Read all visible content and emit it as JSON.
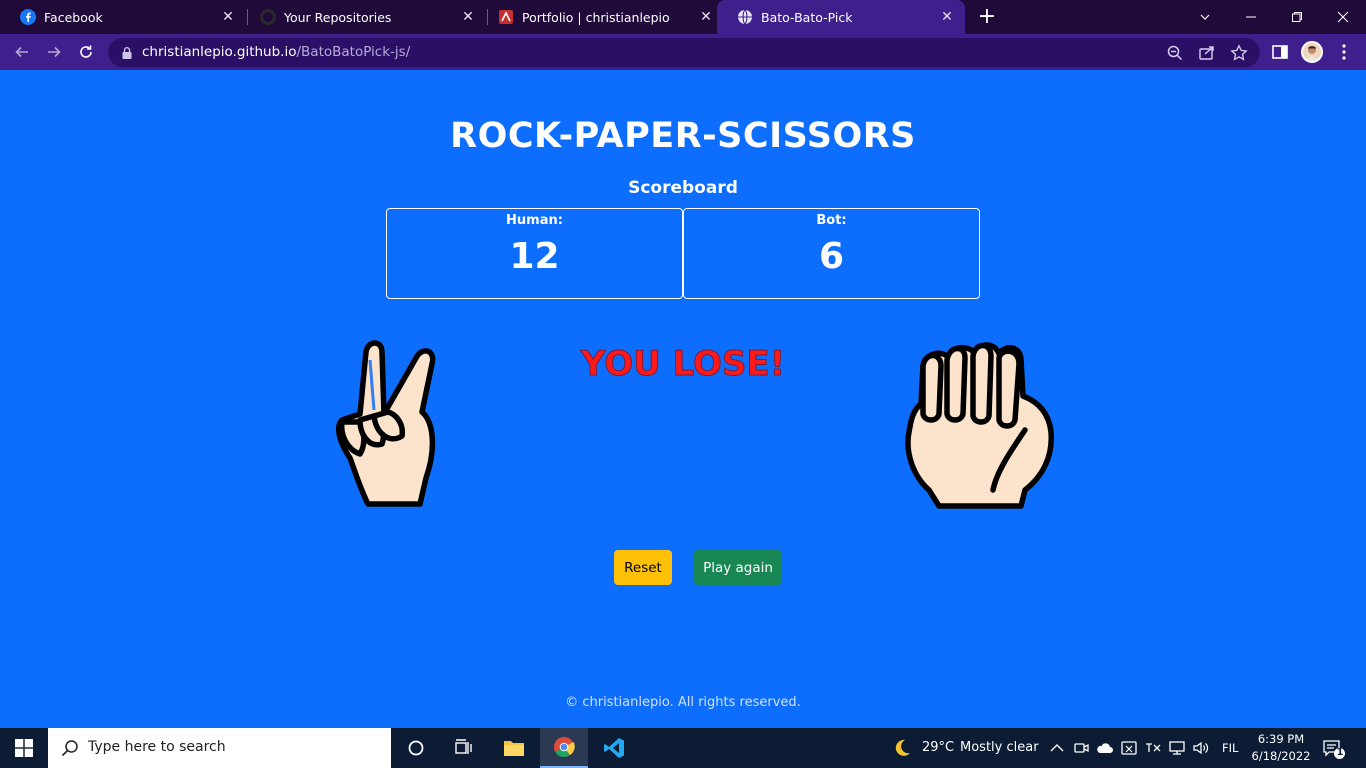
{
  "browser": {
    "tabs": [
      {
        "title": "Facebook",
        "icon": "facebook-icon",
        "active": false
      },
      {
        "title": "Your Repositories",
        "icon": "github-icon",
        "active": false
      },
      {
        "title": "Portfolio | christianlepio",
        "icon": "portfolio-icon",
        "active": false
      },
      {
        "title": "Bato-Bato-Pick",
        "icon": "globe-icon",
        "active": true
      }
    ],
    "url_domain": "christianlepio.github.io",
    "url_path": "/BatoBatoPick-js/"
  },
  "game": {
    "title": "ROCK-PAPER-SCISSORS",
    "scoreboard_label": "Scoreboard",
    "human_label": "Human:",
    "human_score": "12",
    "bot_label": "Bot:",
    "bot_score": "6",
    "result": "YOU LOSE!",
    "human_choice": "scissors",
    "bot_choice": "rock",
    "reset_label": "Reset",
    "play_again_label": "Play again",
    "footer": "© christianlepio. All rights reserved."
  },
  "taskbar": {
    "search_placeholder": "Type here to search",
    "weather_temp": "29°C",
    "weather_desc": "Mostly clear",
    "language": "FIL",
    "time": "6:39 PM",
    "date": "6/18/2022",
    "notification_count": "1"
  },
  "colors": {
    "page_bg": "#0d6efd",
    "result_red": "#ff1a1a",
    "reset_yellow": "#ffc107",
    "play_green": "#198754",
    "tabstrip": "#1f0a3a",
    "toolbar": "#3e1f8c"
  }
}
